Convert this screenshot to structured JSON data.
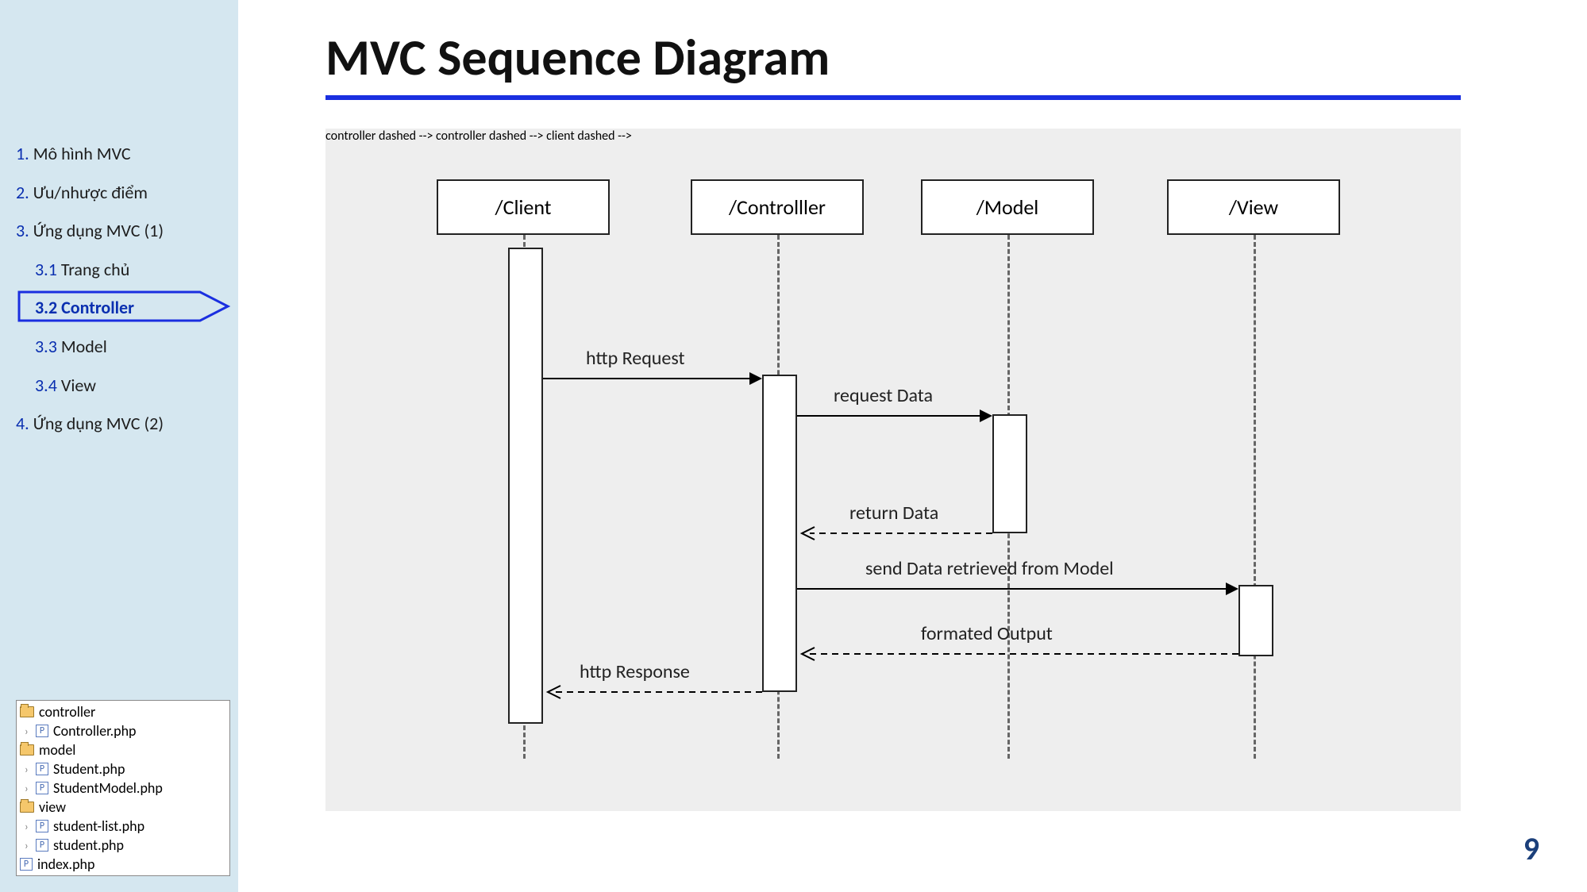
{
  "title": "MVC Sequence Diagram",
  "page_number": "9",
  "outline": {
    "item1_num": "1.",
    "item1_text": " Mô hình MVC",
    "item2_num": "2.",
    "item2_text": " Ưu/nhược điểm",
    "item3_num": "3.",
    "item3_text": " Ứng dụng MVC (1)",
    "item31_num": "3.1",
    "item31_text": " Trang chủ",
    "item32_num": "3.2",
    "item32_text": " Controller",
    "item33_num": "3.3",
    "item33_text": " Model",
    "item34_num": "3.4",
    "item34_text": " View",
    "item4_num": "4.",
    "item4_text": " Ứng dụng MVC (2)"
  },
  "tree": {
    "folder_controller": "controller",
    "file_controller_php": "Controller.php",
    "folder_model": "model",
    "file_student_php": "Student.php",
    "file_studentmodel_php": "StudentModel.php",
    "folder_view": "view",
    "file_studentlist_php": "student-list.php",
    "file_student2_php": "student.php",
    "file_index_php": "index.php"
  },
  "diagram": {
    "heads": {
      "client": "/Client",
      "controller": "/Controlller",
      "model": "/Model",
      "view": "/View"
    },
    "msg": {
      "http_request": "http Request",
      "request_data": "request Data",
      "return_data": "return Data",
      "send_data": "send Data retrieved from Model",
      "formated_output": "formated Output",
      "http_response": "http Response"
    }
  }
}
